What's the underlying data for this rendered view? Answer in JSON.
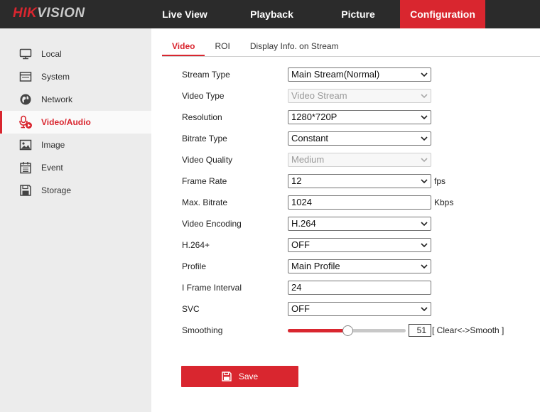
{
  "brand": {
    "part1": "HIK",
    "part2": "VISION"
  },
  "top_nav": [
    {
      "label": "Live View"
    },
    {
      "label": "Playback"
    },
    {
      "label": "Picture"
    },
    {
      "label": "Configuration",
      "active": true
    }
  ],
  "sidebar": {
    "items": [
      {
        "label": "Local",
        "icon": "monitor-icon"
      },
      {
        "label": "System",
        "icon": "system-icon"
      },
      {
        "label": "Network",
        "icon": "globe-icon"
      },
      {
        "label": "Video/Audio",
        "icon": "microphone-icon",
        "active": true
      },
      {
        "label": "Image",
        "icon": "image-icon"
      },
      {
        "label": "Event",
        "icon": "calendar-icon"
      },
      {
        "label": "Storage",
        "icon": "floppy-icon"
      }
    ]
  },
  "tabs": [
    {
      "label": "Video",
      "active": true
    },
    {
      "label": "ROI"
    },
    {
      "label": "Display Info. on Stream"
    }
  ],
  "form": {
    "stream_type": {
      "label": "Stream Type",
      "value": "Main Stream(Normal)"
    },
    "video_type": {
      "label": "Video Type",
      "value": "Video Stream",
      "disabled": true
    },
    "resolution": {
      "label": "Resolution",
      "value": "1280*720P"
    },
    "bitrate_type": {
      "label": "Bitrate Type",
      "value": "Constant"
    },
    "video_quality": {
      "label": "Video Quality",
      "value": "Medium",
      "disabled": true
    },
    "frame_rate": {
      "label": "Frame Rate",
      "value": "12",
      "unit": "fps"
    },
    "max_bitrate": {
      "label": "Max. Bitrate",
      "value": "1024",
      "unit": "Kbps"
    },
    "video_encoding": {
      "label": "Video Encoding",
      "value": "H.264"
    },
    "h264_plus": {
      "label": "H.264+",
      "value": "OFF"
    },
    "profile": {
      "label": "Profile",
      "value": "Main Profile"
    },
    "i_frame_interval": {
      "label": "I Frame Interval",
      "value": "24"
    },
    "svc": {
      "label": "SVC",
      "value": "OFF"
    },
    "smoothing": {
      "label": "Smoothing",
      "value": "51",
      "level": 0.51,
      "hint": "[ Clear<->Smooth ]"
    }
  },
  "save_button": {
    "label": "Save"
  },
  "colors": {
    "accent": "#d9262f",
    "topbar": "#2b2b2b",
    "sidebar": "#ececec"
  }
}
